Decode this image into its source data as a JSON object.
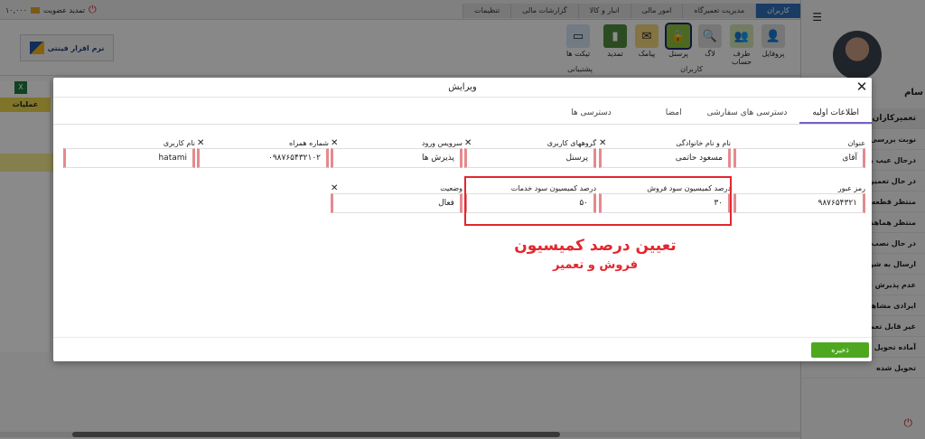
{
  "topbar": {
    "menu_tabs": [
      "کاربران",
      "مدیریت تعمیرگاه",
      "امور مالی",
      "انبار و کالا",
      "گزارشات مالی",
      "تنظیمات"
    ],
    "membership_label": "تمدید عضویت",
    "balance": "۱۰,۰۰۰"
  },
  "ribbon": {
    "buttons": [
      {
        "label": "پروفایل",
        "icon": "profile-icon"
      },
      {
        "label": "طرف حساب",
        "icon": "users-group-icon"
      },
      {
        "label": "لاگ",
        "icon": "search-icon"
      },
      {
        "label": "پرسنل",
        "icon": "lock-icon"
      },
      {
        "label": "پیامک",
        "icon": "sms-icon"
      },
      {
        "label": "تمدید",
        "icon": "renew-icon"
      },
      {
        "label": "تیکت ها",
        "icon": "ticket-icon"
      }
    ],
    "group_users": "کاربران",
    "group_support": "پشتیبانی"
  },
  "logo_text": "نرم افزار فینتی",
  "left_panel": {
    "ops_header": "عملیات"
  },
  "sidebar": {
    "user_name": "سام",
    "section_title": "تعمیرکاران",
    "items": [
      "نوبت بررسی",
      "درحال عیب یابی",
      "در حال تعمیر",
      "منتظر قطعه",
      "منتظر هماهنگی",
      "در حال نصب برنامه",
      "ارسال به شرکت گارانتی",
      "عدم پذیرش تعمیر",
      "ایرادی مشاهده نشد",
      "غیر قابل تعمیر",
      "آماده تحویل",
      "تحویل شده"
    ]
  },
  "modal": {
    "title": "ویرایش",
    "tabs": [
      "اطلاعات اولیه",
      "دسترسی های سفارشی",
      "امضا",
      "دسترسی ها"
    ],
    "fields": {
      "title": {
        "label": "عنوان",
        "value": "آقای"
      },
      "full_name": {
        "label": "نام و نام خانوادگی",
        "value": "مسعود حاتمی"
      },
      "user_groups": {
        "label": "گروههای کاربری",
        "value": "پرسنل"
      },
      "login_service": {
        "label": "سرویس ورود",
        "value": "پذیرش ها"
      },
      "mobile": {
        "label": "شماره همراه",
        "value": "۰۹۸۷۶۵۴۳۲۱۰۲"
      },
      "username": {
        "label": "نام کاربری",
        "value": "hatami"
      },
      "password": {
        "label": "رمز عبور",
        "value": "۹۸۷۶۵۴۳۲۱"
      },
      "sales_commission": {
        "label": "درصد کمیسیون سود فروش",
        "value": "۳۰"
      },
      "service_commission": {
        "label": "درصد کمیسیون سود خدمات",
        "value": "۵۰"
      },
      "status": {
        "label": "وضعیت",
        "value": "فعال"
      }
    },
    "save_label": "ذخیره"
  },
  "annotation": {
    "line1": "تعیین درصد کمیسیون",
    "line2": "فروش و تعمیر"
  },
  "colors": {
    "accent": "#2f6eb6",
    "save": "#4ea81f",
    "highlight": "#e3262e",
    "tab_active": "#7a5fc7"
  }
}
